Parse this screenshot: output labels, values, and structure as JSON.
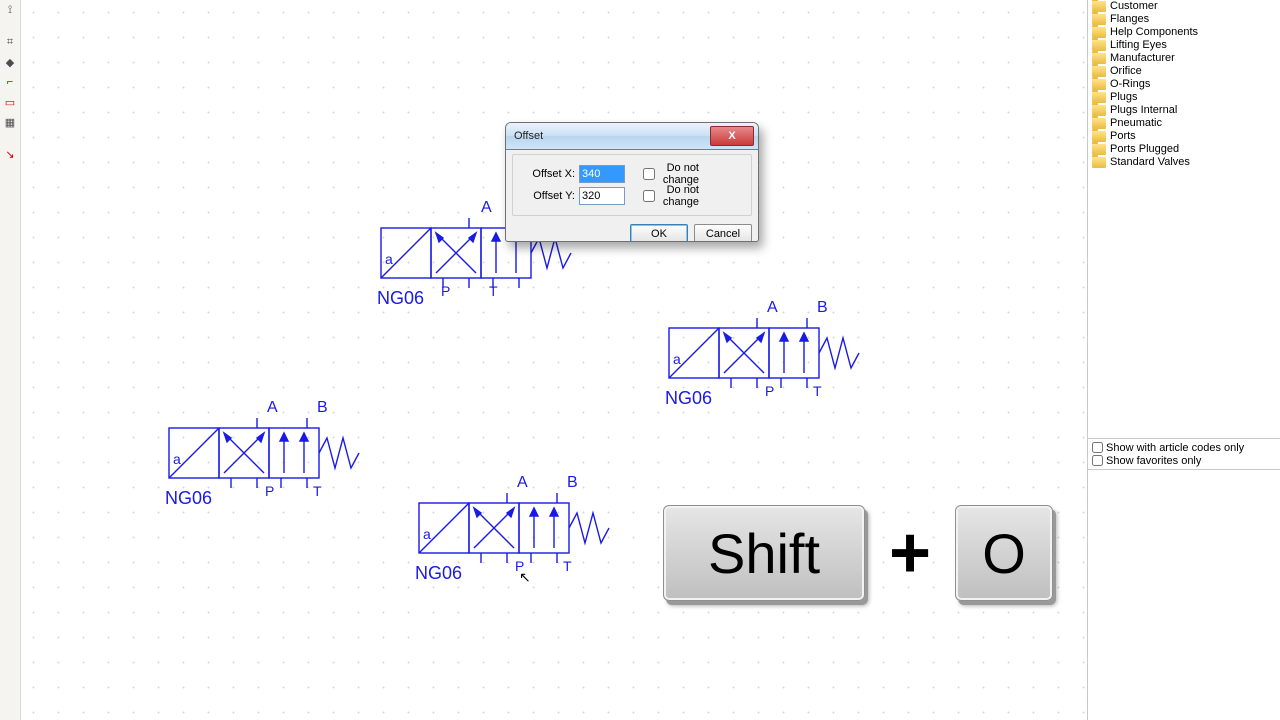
{
  "dialog": {
    "title": "Offset",
    "close_symbol": "X",
    "offset_x_label": "Offset X:",
    "offset_x_value": "340",
    "offset_y_label": "Offset Y:",
    "offset_y_value": "320",
    "nochange_x": "Do not change",
    "nochange_y": "Do not change",
    "ok_label": "OK",
    "cancel_label": "Cancel"
  },
  "tree_items": [
    "Customer",
    "Flanges",
    "Help Components",
    "Lifting Eyes",
    "Manufacturer",
    "Orifice",
    "O-Rings",
    "Plugs",
    "Plugs Internal",
    "Pneumatic",
    "Ports",
    "Ports Plugged",
    "Standard Valves"
  ],
  "filters": {
    "article_codes": "Show with article codes only",
    "favorites": "Show favorites only"
  },
  "valve": {
    "type_tag": "NG06",
    "port_a": "A",
    "port_b": "B",
    "port_p": "P",
    "port_t": "T",
    "port_a_ctrl": "a"
  },
  "kbd": {
    "shift": "Shift",
    "plus": "+",
    "o": "O"
  }
}
